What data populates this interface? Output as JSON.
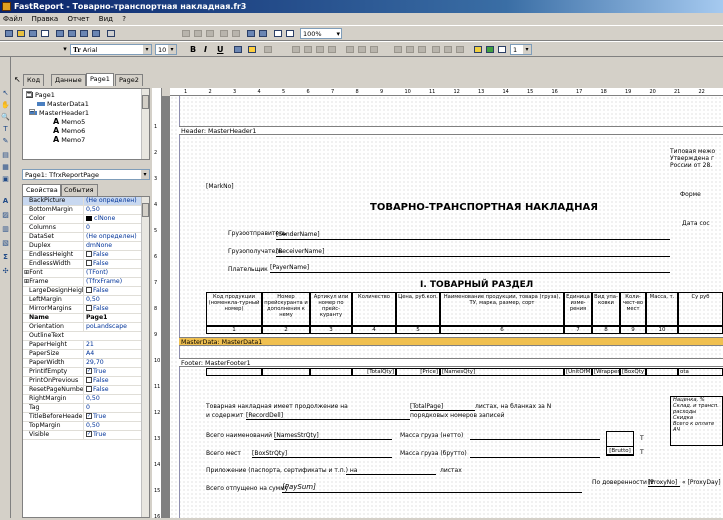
{
  "window": {
    "title": "FastReport - Товарно-транспортная накладная.fr3"
  },
  "menu": [
    "Файл",
    "Правка",
    "Отчет",
    "Вид",
    "?"
  ],
  "toolbar": {
    "zoom": "100%",
    "font_size": "10",
    "font_name": "Arial",
    "font_bold": "B",
    "font_italic": "I",
    "font_underline": "U",
    "frame_width": "1"
  },
  "tabs": [
    "Код",
    "Данные",
    "Page1",
    "Page2"
  ],
  "tree": {
    "nodes": [
      {
        "label": "Page1"
      },
      {
        "label": "MasterData1"
      },
      {
        "label": "MasterHeader1"
      },
      {
        "label": "Memo5"
      },
      {
        "label": "Memo6"
      },
      {
        "label": "Memo7"
      }
    ]
  },
  "object_selector": "Page1: TfrxReportPage",
  "prop_tabs": [
    "Свойства",
    "События"
  ],
  "properties": [
    {
      "name": "BackPicture",
      "value": "(Не определен)"
    },
    {
      "name": "BottomMargin",
      "value": "0,50"
    },
    {
      "name": "Color",
      "value": "clNone"
    },
    {
      "name": "Columns",
      "value": "0"
    },
    {
      "name": "DataSet",
      "value": "(Не определен)"
    },
    {
      "name": "Duplex",
      "value": "dmNone"
    },
    {
      "name": "EndlessHeight",
      "value": "False"
    },
    {
      "name": "EndlessWidth",
      "value": "False"
    },
    {
      "name": "Font",
      "value": "(TFont)"
    },
    {
      "name": "Frame",
      "value": "(TfrxFrame)"
    },
    {
      "name": "LargeDesignHeight",
      "value": "False"
    },
    {
      "name": "LeftMargin",
      "value": "0,50"
    },
    {
      "name": "MirrorMargins",
      "value": "False"
    },
    {
      "name": "Name",
      "value": "Page1"
    },
    {
      "name": "Orientation",
      "value": "poLandscape"
    },
    {
      "name": "OutlineText",
      "value": ""
    },
    {
      "name": "PaperHeight",
      "value": "21"
    },
    {
      "name": "PaperSize",
      "value": "A4"
    },
    {
      "name": "PaperWidth",
      "value": "29,70"
    },
    {
      "name": "PrintIfEmpty",
      "value": "True"
    },
    {
      "name": "PrintOnPrevious",
      "value": "False"
    },
    {
      "name": "ResetPageNumbers",
      "value": "False"
    },
    {
      "name": "RightMargin",
      "value": "0,50"
    },
    {
      "name": "Tag",
      "value": "0"
    },
    {
      "name": "TitleBeforeHeader",
      "value": "True"
    },
    {
      "name": "TopMargin",
      "value": "0,50"
    },
    {
      "name": "Visible",
      "value": "True"
    }
  ],
  "ruler": {
    "h": [
      "1",
      "2",
      "3",
      "4",
      "5",
      "6",
      "7",
      "8",
      "9",
      "10",
      "11",
      "12",
      "13",
      "14",
      "15",
      "16",
      "17",
      "18",
      "19",
      "20",
      "21",
      "22"
    ],
    "v": [
      "1",
      "2",
      "3",
      "4",
      "5",
      "6",
      "7",
      "8",
      "9",
      "10",
      "11",
      "12",
      "13",
      "14",
      "15",
      "16"
    ]
  },
  "report": {
    "header_band": "Header: MasterHeader1",
    "master_band": "MasterData: MasterData1",
    "footer_band": "Footer: MasterFooter1",
    "corner_text": [
      "Типовая межо",
      "Утверждена г",
      "России от 28."
    ],
    "forma": "Форме",
    "data_sos": "Дата сос",
    "mark_no": "[MarkNo]",
    "doc_title": "ТОВАРНО-ТРАНСПОРТНАЯ НАКЛАДНАЯ",
    "sender_label": "Грузоотправитель",
    "sender_value": "[SenderName]",
    "receiver_label": "Грузополучатель",
    "receiver_value": "[ReceiverName]",
    "payer_label": "Плательщик",
    "payer_value": "[PayerName]",
    "section_title": "I. ТОВАРНЫЙ РАЗДЕЛ",
    "columns": [
      {
        "label": "Код продукции (номенкла-турный номер)",
        "n": "1"
      },
      {
        "label": "Номер прейскуранта и дополнения к нему",
        "n": "2"
      },
      {
        "label": "Артикул или номер по прейс-куранту",
        "n": "3"
      },
      {
        "label": "Количество",
        "n": "4"
      },
      {
        "label": "Цена, руб.коп.",
        "n": "5"
      },
      {
        "label": "Наименование продукции, товара (груза), ТУ, марка, размер, сорт",
        "n": "6"
      },
      {
        "label": "Единица изме-рения",
        "n": "7"
      },
      {
        "label": "Вид упа-ковки",
        "n": "8"
      },
      {
        "label": "Коли-чест-во мест",
        "n": "9"
      },
      {
        "label": "Масса, т.",
        "n": "10"
      },
      {
        "label": "Су руб",
        "n": ""
      }
    ],
    "footer_fields": [
      "[TotalQty]",
      "[Price]",
      "[NamesQty]",
      "[UnitOfM]",
      "[Wrapper]",
      "[BoxQty]",
      "ota"
    ],
    "lines": {
      "cont_text": "Товарная накладная имеет продолжение на",
      "total_page": "[TotalPage]",
      "sheets_text": "листах, на бланках за N",
      "contains": "и содержит",
      "record_dell": "[RecordDell]",
      "serial_text": "порядковых номеров записей",
      "names_total": "Всего наименований",
      "names_str": "[NamesStrQty]",
      "mass_net": "Масса груза (нетто)",
      "places_total": "Всего мест",
      "box_str": "[BoxStrQty]",
      "mass_gross": "Масса груза (брутто)",
      "brutto": "[Brutto]",
      "t1": "Т",
      "t2": "Т",
      "attach": "Приложение (паспорта, сертификаты и т.п.) на",
      "sheets": "листах",
      "released": "Всего отпущено на сумму",
      "pay_sum": "[PaySum]",
      "proxy_text": "По доверенности N",
      "proxy_no": "[ProxyNo]",
      "proxy_day": "« [ProxyDay]"
    },
    "right_box": [
      "Наценка, %",
      "Склад. и трансп. расходы",
      "Скидка",
      "Всего к оплате",
      "АЧ"
    ]
  }
}
